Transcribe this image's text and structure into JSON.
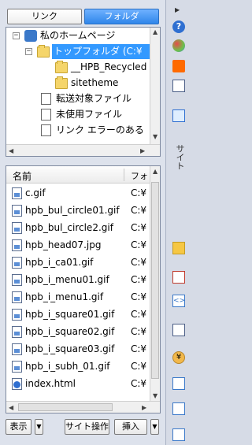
{
  "tabs": {
    "links": "リンク",
    "folders": "フォルダ"
  },
  "tree": {
    "items": [
      {
        "label": "私のホームページ",
        "level": 0
      },
      {
        "label": "トップフォルダ (C:¥",
        "level": 1,
        "selected": true
      },
      {
        "label": "__HPB_Recycled",
        "level": 2
      },
      {
        "label": "sitetheme",
        "level": 2
      },
      {
        "label": "転送対象ファイル",
        "level": 1
      },
      {
        "label": "未使用ファイル",
        "level": 1
      },
      {
        "label": "リンク エラーのある",
        "level": 1
      }
    ]
  },
  "files": {
    "columns": {
      "name": "名前",
      "folder": "フォ"
    },
    "rows": [
      {
        "name": "c.gif",
        "path": "C:¥",
        "kind": "image"
      },
      {
        "name": "hpb_bul_circle01.gif",
        "path": "C:¥",
        "kind": "image"
      },
      {
        "name": "hpb_bul_circle2.gif",
        "path": "C:¥",
        "kind": "image"
      },
      {
        "name": "hpb_head07.jpg",
        "path": "C:¥",
        "kind": "image"
      },
      {
        "name": "hpb_i_ca01.gif",
        "path": "C:¥",
        "kind": "image"
      },
      {
        "name": "hpb_i_menu01.gif",
        "path": "C:¥",
        "kind": "image"
      },
      {
        "name": "hpb_i_menu1.gif",
        "path": "C:¥",
        "kind": "image"
      },
      {
        "name": "hpb_i_square01.gif",
        "path": "C:¥",
        "kind": "image"
      },
      {
        "name": "hpb_i_square02.gif",
        "path": "C:¥",
        "kind": "image"
      },
      {
        "name": "hpb_i_square03.gif",
        "path": "C:¥",
        "kind": "image"
      },
      {
        "name": "hpb_i_subh_01.gif",
        "path": "C:¥",
        "kind": "image"
      },
      {
        "name": "index.html",
        "path": "C:¥",
        "kind": "html"
      }
    ]
  },
  "buttons": {
    "view": "表示",
    "site_ops": "サイト操作",
    "insert": "挿入"
  },
  "sidebar": {
    "site_label": "サイト"
  }
}
